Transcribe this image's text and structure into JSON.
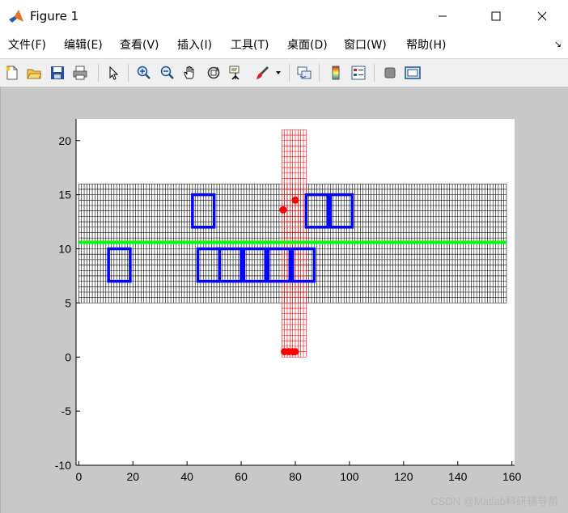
{
  "window": {
    "title": "Figure 1",
    "icon": "matlab-logo-icon",
    "controls": [
      "minimize-icon",
      "maximize-icon",
      "close-icon"
    ]
  },
  "menu": {
    "items": [
      "文件(F)",
      "编辑(E)",
      "查看(V)",
      "插入(I)",
      "工具(T)",
      "桌面(D)",
      "窗口(W)",
      "帮助(H)"
    ],
    "dock_arrow": "↘"
  },
  "toolbar": {
    "icons": [
      "new-figure-icon",
      "open-file-icon",
      "save-icon",
      "print-icon",
      "select-arrow-icon",
      "zoom-in-icon",
      "zoom-out-icon",
      "pan-hand-icon",
      "rotate-3d-icon",
      "data-cursor-icon",
      "brush-icon",
      "link-plot-icon",
      "colorbar-icon",
      "legend-icon",
      "hide-plot-tools-icon",
      "show-plot-tools-icon"
    ]
  },
  "colors": {
    "grid_black": "#000000",
    "grid_red": "#ff0000",
    "line_green": "#00ff00",
    "rect_blue": "#0000ff",
    "marker_red": "#ff0000",
    "canvas_bg": "#c8c8c8",
    "axes_bg": "#ffffff"
  },
  "chart_data": {
    "type": "scatter",
    "xlim": [
      -1,
      161
    ],
    "ylim": [
      -10,
      22
    ],
    "xticks": [
      0,
      20,
      40,
      60,
      80,
      100,
      120,
      140,
      160
    ],
    "yticks": [
      -10,
      -5,
      0,
      5,
      10,
      15,
      20
    ],
    "grid": false,
    "black_mesh": {
      "x_range": [
        0,
        158
      ],
      "y_range": [
        5,
        16
      ],
      "dx": 1,
      "dy": 0.5
    },
    "red_mesh": {
      "x_range": [
        75,
        84
      ],
      "y_range": [
        0,
        21
      ],
      "dx": 1,
      "dy": 0.5
    },
    "green_line": {
      "x": [
        0,
        158
      ],
      "y": [
        10.6,
        10.6
      ]
    },
    "blue_rects": [
      {
        "x": [
          11,
          19
        ],
        "y": [
          7,
          10
        ]
      },
      {
        "x": [
          42,
          50
        ],
        "y": [
          12,
          15
        ]
      },
      {
        "x": [
          44,
          52
        ],
        "y": [
          7,
          10
        ]
      },
      {
        "x": [
          52,
          60
        ],
        "y": [
          7,
          10
        ]
      },
      {
        "x": [
          61,
          69
        ],
        "y": [
          7,
          10
        ]
      },
      {
        "x": [
          70,
          78
        ],
        "y": [
          7,
          10
        ]
      },
      {
        "x": [
          79,
          87
        ],
        "y": [
          7,
          10
        ]
      },
      {
        "x": [
          84,
          92
        ],
        "y": [
          12,
          15
        ]
      },
      {
        "x": [
          93,
          101
        ],
        "y": [
          12,
          15
        ]
      }
    ],
    "red_points": [
      {
        "x": 75.5,
        "y": 13.6
      },
      {
        "x": 80,
        "y": 14.5
      },
      {
        "x": 76,
        "y": 0.5
      },
      {
        "x": 77.5,
        "y": 0.5
      },
      {
        "x": 79,
        "y": 0.5
      },
      {
        "x": 80,
        "y": 0.5
      }
    ]
  },
  "watermark": "CSDN @Matlab科研辅导帮"
}
